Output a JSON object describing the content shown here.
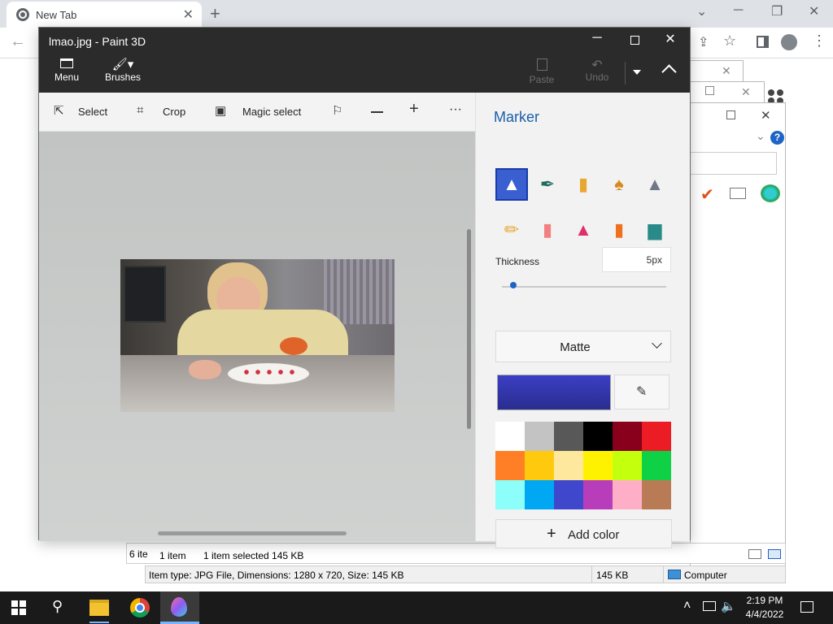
{
  "chrome": {
    "tab_title": "New Tab",
    "new_tab_symbol": "+",
    "minimize_symbol": "─",
    "restore_symbol": "❐",
    "close_symbol": "✕",
    "chevron_symbol": "⌄"
  },
  "explorer": {
    "items_count_partial": "6 ite",
    "items_count": "1 item",
    "items_selected": "1 item selected  145 KB",
    "details": "Item type: JPG File, Dimensions: 1280 x 720, Size: 145 KB",
    "size": "145 KB",
    "location": "Computer"
  },
  "paint3d": {
    "title": "lmao.jpg - Paint 3D",
    "commands": {
      "menu": "Menu",
      "brushes": "Brushes",
      "paste": "Paste",
      "undo": "Undo"
    },
    "tools": {
      "select": "Select",
      "crop": "Crop",
      "magic_select": "Magic select",
      "more": "···"
    },
    "panel": {
      "title": "Marker",
      "thickness_label": "Thickness",
      "thickness_value": "5px",
      "thickness_fraction": 0.05,
      "finish": "Matte",
      "selected_color": "#3b3fc4",
      "add_color": "Add color",
      "palette": [
        "#ffffff",
        "#c3c3c3",
        "#585858",
        "#000000",
        "#88001b",
        "#ec1c24",
        "#ff7f27",
        "#ffc90e",
        "#fde89e",
        "#fff200",
        "#c4ff0e",
        "#0ed145",
        "#8cfffb",
        "#00a8f3",
        "#3f48cc",
        "#b83dba",
        "#ffaec8",
        "#b97a56"
      ],
      "brush_icons": [
        "marker-icon",
        "calligraphy-pen-icon",
        "oil-brush-icon",
        "watercolor-icon",
        "pixel-pen-icon",
        "pencil-icon",
        "eraser-icon",
        "crayon-icon",
        "spray-can-icon",
        "fill-bucket-icon"
      ]
    }
  },
  "taskbar": {
    "time": "2:19 PM",
    "date": "4/4/2022"
  }
}
